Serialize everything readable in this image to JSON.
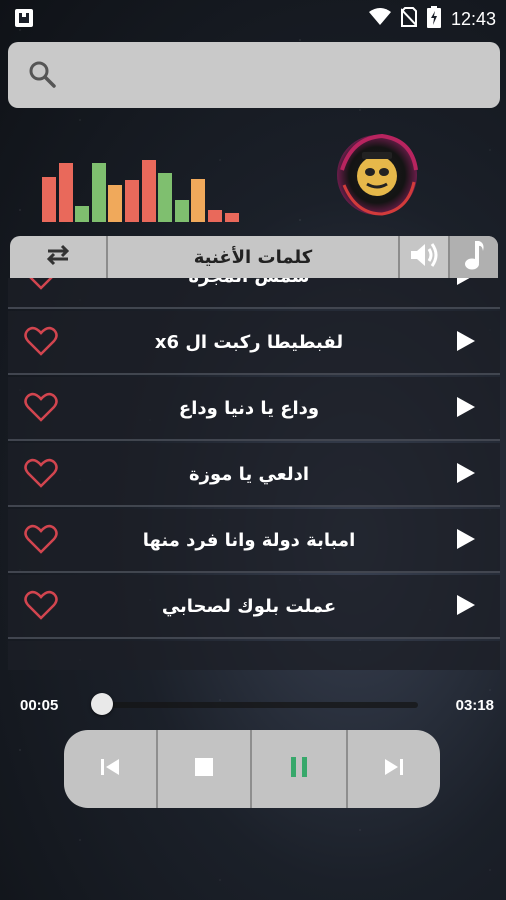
{
  "status_bar": {
    "time": "12:43",
    "icons": [
      "notification-icon",
      "wifi-icon",
      "no-sim-icon",
      "battery-charging-icon"
    ]
  },
  "search": {
    "placeholder": "",
    "icon": "search-icon"
  },
  "equalizer": {
    "levels": [
      0.62,
      0.82,
      0.22,
      0.82,
      0.52,
      0.58,
      0.86,
      0.68,
      0.3,
      0.6,
      0.16,
      0.12
    ],
    "colors": [
      "#e9695b",
      "#e9695b",
      "#7fbf6f",
      "#7fbf6f",
      "#f0a95b",
      "#e9695b",
      "#e9695b",
      "#7fbf6f",
      "#7fbf6f",
      "#f0a95b",
      "#e9695b",
      "#e9695b"
    ]
  },
  "logo": {
    "icon": "monkey-logo-icon"
  },
  "tabs": {
    "lyrics_label": "كلمات الأغنية",
    "icons": [
      "repeat-icon",
      "volume-icon",
      "music-note-icon"
    ]
  },
  "songs": [
    {
      "title": "شمس المجرة"
    },
    {
      "title": "لفبطيطا ركبت ال x6"
    },
    {
      "title": "وداع يا دنيا وداع"
    },
    {
      "title": "ادلعي يا موزة"
    },
    {
      "title": "امبابة دولة وانا فرد منها"
    },
    {
      "title": "عملت بلوك لصحابي"
    }
  ],
  "player": {
    "current_time": "00:05",
    "total_time": "03:18",
    "progress": 0.03
  },
  "controls": {
    "icons": [
      "skip-previous-icon",
      "stop-icon",
      "pause-icon",
      "skip-next-icon"
    ],
    "accent_color": "#38a86b"
  }
}
